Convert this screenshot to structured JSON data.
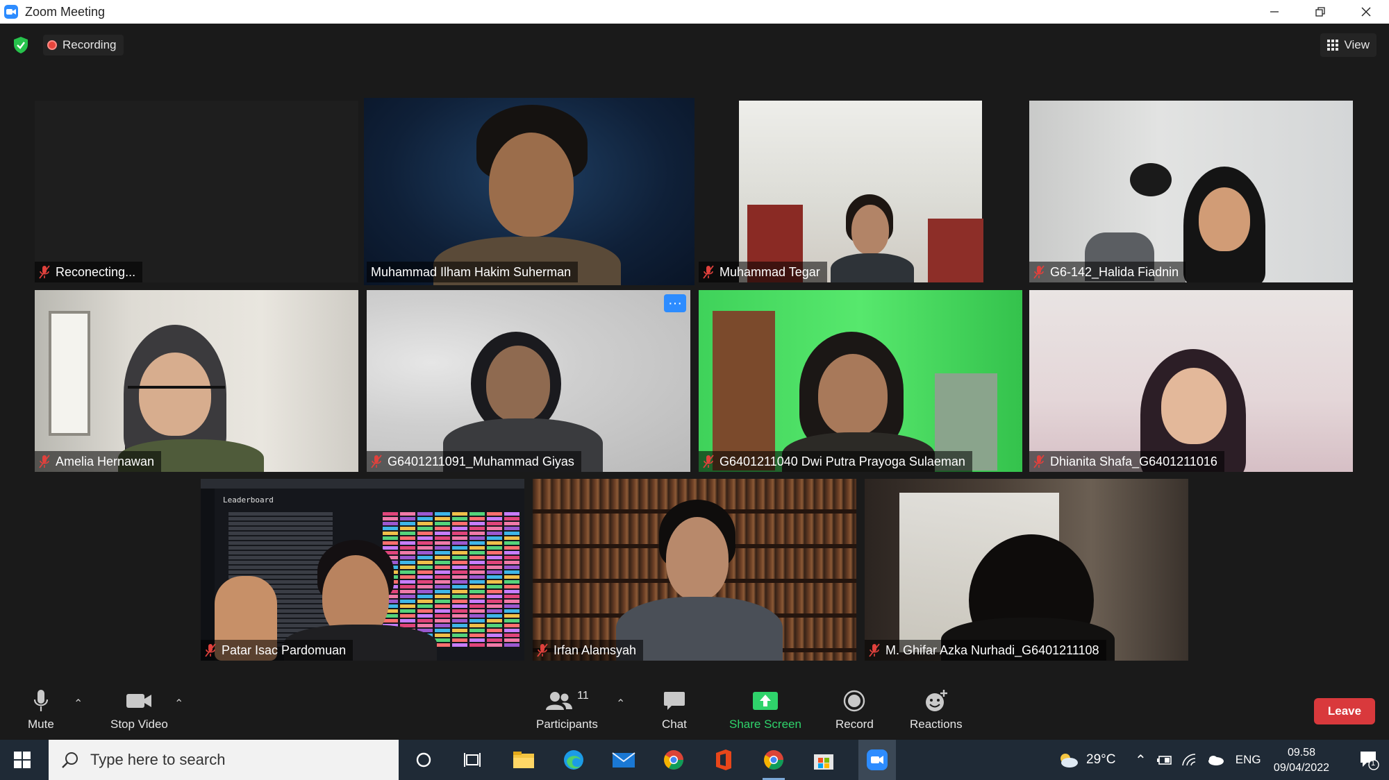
{
  "window": {
    "title": "Zoom Meeting"
  },
  "header": {
    "recording_label": "Recording",
    "view_label": "View"
  },
  "tiles": [
    {
      "name": "Reconecting...",
      "muted": true
    },
    {
      "name": "Muhammad Ilham Hakim Suherman",
      "muted": false,
      "speaking": true
    },
    {
      "name": "Muhammad Tegar",
      "muted": true
    },
    {
      "name": "G6-142_Halida Fiadnin",
      "muted": true
    },
    {
      "name": "Amelia Hernawan",
      "muted": true
    },
    {
      "name": "G6401211091_Muhammad Giyas",
      "muted": true,
      "more_label": "···"
    },
    {
      "name": "G6401211040 Dwi Putra Prayoga Sulaeman",
      "muted": true
    },
    {
      "name": "Dhianita Shafa_G6401211016",
      "muted": true
    },
    {
      "name": "Patar Isac Pardomuan",
      "muted": true,
      "shared_title": "Leaderboard"
    },
    {
      "name": "Irfan Alamsyah",
      "muted": true
    },
    {
      "name": "M. Ghifar Azka Nurhadi_G6401211108",
      "muted": true
    }
  ],
  "toolbar": {
    "mute_label": "Mute",
    "stop_video_label": "Stop Video",
    "participants_label": "Participants",
    "participants_count": "11",
    "chat_label": "Chat",
    "share_screen_label": "Share Screen",
    "record_label": "Record",
    "reactions_label": "Reactions",
    "leave_label": "Leave"
  },
  "taskbar": {
    "search_placeholder": "Type here to search",
    "weather": "29°C",
    "language": "ENG",
    "time": "09.58",
    "date": "09/04/2022",
    "notification_count": "1"
  },
  "colors": {
    "speaking_border": "#d6e34a",
    "share_green": "#2fd36b",
    "leave_red": "#d9393c",
    "zoom_blue": "#2d8cff"
  }
}
